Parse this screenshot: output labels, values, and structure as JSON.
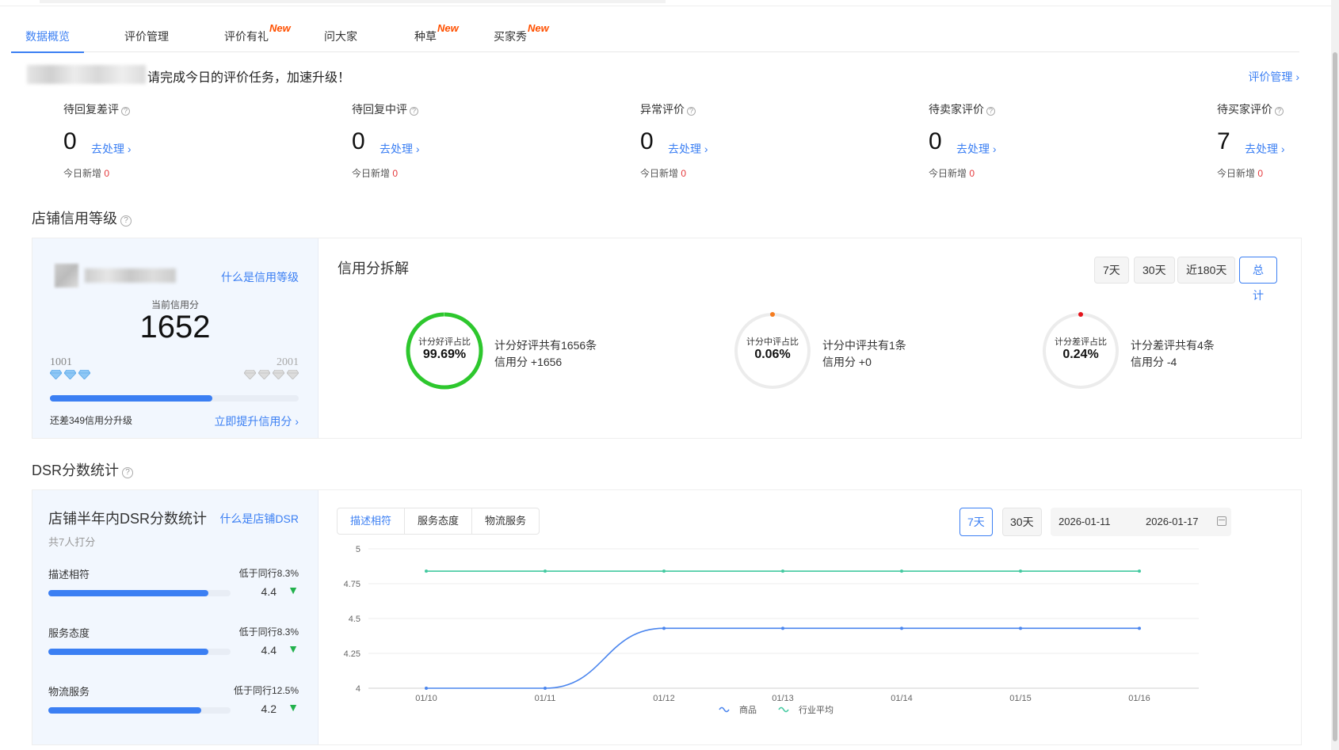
{
  "tabs": [
    {
      "label": "数据概览",
      "active": true,
      "new": ""
    },
    {
      "label": "评价管理",
      "active": false,
      "new": ""
    },
    {
      "label": "评价有礼",
      "active": false,
      "new": "New"
    },
    {
      "label": "问大家",
      "active": false,
      "new": ""
    },
    {
      "label": "种草",
      "active": false,
      "new": "New"
    },
    {
      "label": "买家秀",
      "active": false,
      "new": "New"
    }
  ],
  "task": {
    "text": "请完成今日的评价任务，加速升级！",
    "manage_link": "评价管理 ›"
  },
  "stats": [
    {
      "label": "待回复差评",
      "value": "0",
      "action": "去处理 ›",
      "today_label": "今日新增",
      "today_value": "0"
    },
    {
      "label": "待回复中评",
      "value": "0",
      "action": "去处理 ›",
      "today_label": "今日新增",
      "today_value": "0"
    },
    {
      "label": "异常评价",
      "value": "0",
      "action": "去处理 ›",
      "today_label": "今日新增",
      "today_value": "0"
    },
    {
      "label": "待卖家评价",
      "value": "0",
      "action": "去处理 ›",
      "today_label": "今日新增",
      "today_value": "0"
    },
    {
      "label": "待买家评价",
      "value": "7",
      "action": "去处理 ›",
      "today_label": "今日新增",
      "today_value": "0"
    }
  ],
  "credit": {
    "section_title": "店铺信用等级",
    "what_link": "什么是信用等级",
    "current_label": "当前信用分",
    "current_score": "1652",
    "level_low": "1001",
    "level_high": "2001",
    "progress": 0.652,
    "remain_text": "还差349信用分升级",
    "boost_link": "立即提升信用分 ›",
    "breakdown_title": "信用分拆解",
    "periods": [
      {
        "label": "7天",
        "active": false
      },
      {
        "label": "30天",
        "active": false
      },
      {
        "label": "近180天",
        "active": false
      },
      {
        "label": "总计",
        "active": true
      }
    ],
    "rings": [
      {
        "label": "计分好评占比",
        "value": "99.69%",
        "fraction": 0.9969,
        "color": "#2dc72d",
        "line1": "计分好评共有1656条",
        "line2": "信用分 +1656"
      },
      {
        "label": "计分中评占比",
        "value": "0.06%",
        "fraction": 0.0006,
        "color": "#f57c1f",
        "line1": "计分中评共有1条",
        "line2": "信用分 +0"
      },
      {
        "label": "计分差评占比",
        "value": "0.24%",
        "fraction": 0.0024,
        "color": "#e4131b",
        "line1": "计分差评共有4条",
        "line2": "信用分 -4"
      }
    ]
  },
  "dsr": {
    "section_title": "DSR分数统计",
    "card_title": "店铺半年内DSR分数统计",
    "what_link": "什么是店铺DSR",
    "raters": "共7人打分",
    "rows": [
      {
        "name": "描述相符",
        "compare": "低于同行8.3%",
        "score": "4.4",
        "fraction": 0.88,
        "trend": "▼"
      },
      {
        "name": "服务态度",
        "compare": "低于同行8.3%",
        "score": "4.4",
        "fraction": 0.88,
        "trend": "▼"
      },
      {
        "name": "物流服务",
        "compare": "低于同行12.5%",
        "score": "4.2",
        "fraction": 0.84,
        "trend": "▼"
      }
    ],
    "segments": [
      {
        "label": "描述相符",
        "active": true
      },
      {
        "label": "服务态度",
        "active": false
      },
      {
        "label": "物流服务",
        "active": false
      }
    ],
    "ranges": [
      {
        "label": "7天",
        "active": true
      },
      {
        "label": "30天",
        "active": false
      }
    ],
    "date_start": "2026-01-11",
    "date_end": "2026-01-17"
  },
  "chart_data": {
    "type": "line",
    "x": [
      "01/10",
      "01/11",
      "01/12",
      "01/13",
      "01/14",
      "01/15",
      "01/16"
    ],
    "ylim": [
      4,
      5
    ],
    "yticks": [
      "4",
      "4.25",
      "4.5",
      "4.75",
      "5"
    ],
    "grid": true,
    "legend": "bottom",
    "series": [
      {
        "name": "商品",
        "color": "#4a85ee",
        "values": [
          4,
          4,
          4.43,
          4.43,
          4.43,
          4.43,
          4.43
        ]
      },
      {
        "name": "行业平均",
        "color": "#43c9a0",
        "values": [
          4.84,
          4.84,
          4.84,
          4.84,
          4.84,
          4.84,
          4.84
        ]
      }
    ]
  }
}
